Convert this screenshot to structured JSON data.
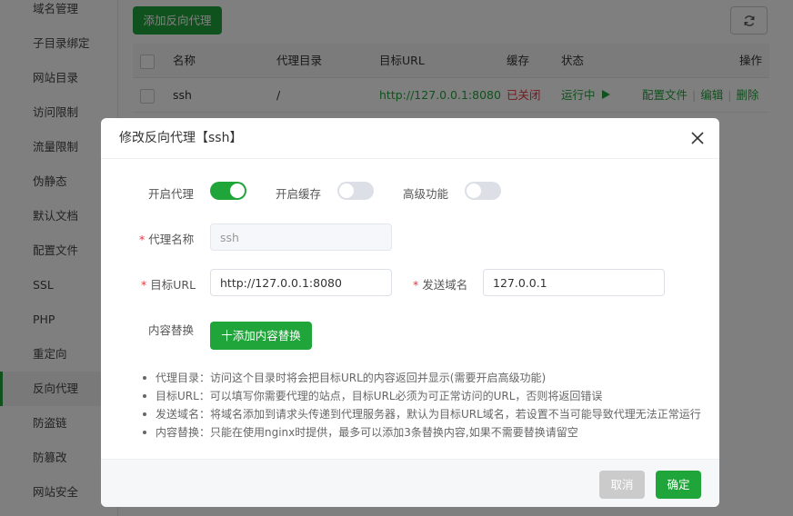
{
  "sidebar": {
    "items": [
      {
        "label": "域名管理"
      },
      {
        "label": "子目录绑定"
      },
      {
        "label": "网站目录"
      },
      {
        "label": "访问限制"
      },
      {
        "label": "流量限制"
      },
      {
        "label": "伪静态"
      },
      {
        "label": "默认文档"
      },
      {
        "label": "配置文件"
      },
      {
        "label": "SSL"
      },
      {
        "label": "PHP"
      },
      {
        "label": "重定向"
      },
      {
        "label": "反向代理",
        "active": true
      },
      {
        "label": "防盗链"
      },
      {
        "label": "防篡改"
      },
      {
        "label": "网站安全"
      }
    ]
  },
  "toolbar": {
    "add_proxy_label": "添加反向代理",
    "refresh_icon": "refresh-icon"
  },
  "table": {
    "headers": [
      "名称",
      "代理目录",
      "目标URL",
      "缓存",
      "状态",
      "操作"
    ],
    "rows": [
      {
        "name": "ssh",
        "dir": "/",
        "url": "http://127.0.0.1:8080",
        "cache": "已关闭",
        "status": "运行中",
        "actions": [
          "配置文件",
          "编辑",
          "删除"
        ]
      }
    ]
  },
  "modal": {
    "title": "修改反向代理【ssh】",
    "toggles": [
      {
        "label": "开启代理",
        "on": true
      },
      {
        "label": "开启缓存",
        "on": false
      },
      {
        "label": "高级功能",
        "on": false
      }
    ],
    "proxy_name": {
      "label": "代理名称",
      "value": "ssh",
      "required": true
    },
    "target_url": {
      "label": "目标URL",
      "value": "http://127.0.0.1:8080",
      "required": true
    },
    "send_domain": {
      "label": "发送域名",
      "value": "127.0.0.1",
      "required": true
    },
    "content_replace": {
      "label": "内容替换",
      "button": "十添加内容替换"
    },
    "tips": [
      "代理目录：访问这个目录时将会把目标URL的内容返回并显示(需要开启高级功能)",
      "目标URL：可以填写你需要代理的站点，目标URL必须为可正常访问的URL，否则将返回错误",
      "发送域名：将域名添加到请求头传递到代理服务器，默认为目标URL域名，若设置不当可能导致代理无法正常运行",
      "内容替换：只能在使用nginx时提供，最多可以添加3条替换内容,如果不需要替换请留空"
    ],
    "cancel_label": "取消",
    "ok_label": "确定"
  },
  "colors": {
    "accent": "#20a53a",
    "danger": "#e8353e",
    "overlay": "rgba(0,0,0,0.5)"
  }
}
